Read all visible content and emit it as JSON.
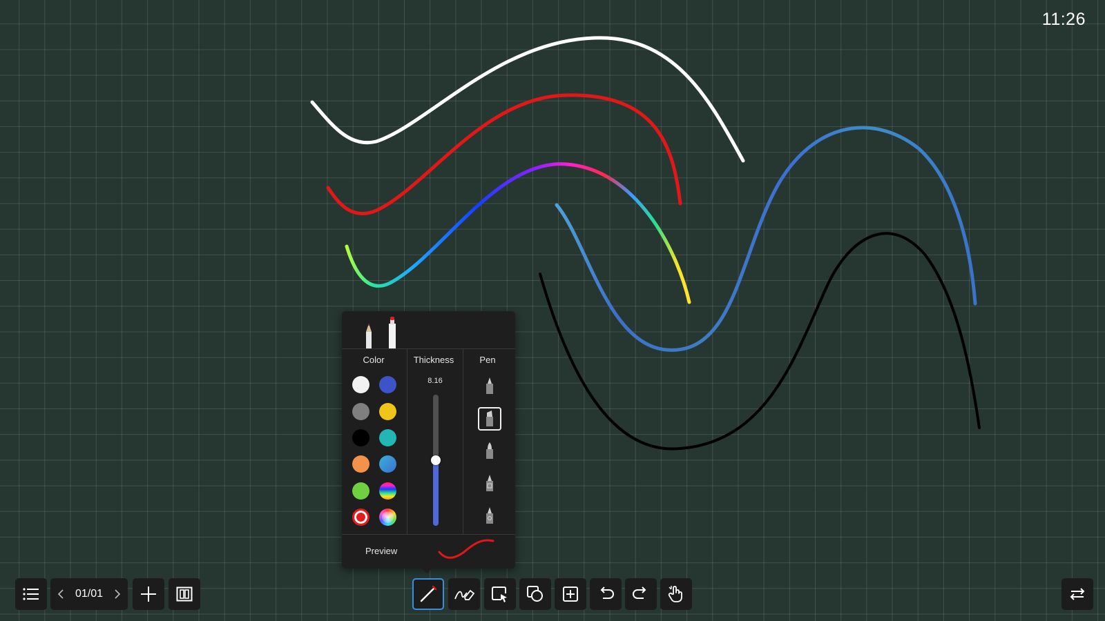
{
  "status_bar": {
    "time": "11:26"
  },
  "canvas": {
    "background": "#263631",
    "grid_color": "#3f4f4a",
    "strokes": [
      {
        "color": "#ffffff",
        "style": "solid"
      },
      {
        "color": "#e01818",
        "style": "solid"
      },
      {
        "color": "rainbow",
        "style": "gradient"
      },
      {
        "color": "blue-teal",
        "style": "gradient"
      },
      {
        "color": "#000000",
        "style": "solid"
      }
    ]
  },
  "pen_panel": {
    "pen_tabs": [
      {
        "icon": "pencil-tip-icon",
        "selected": false
      },
      {
        "icon": "marker-red-icon",
        "selected": true
      }
    ],
    "color_header": "Color",
    "thickness_header": "Thickness",
    "pen_header": "Pen",
    "colors": [
      {
        "name": "white",
        "value": "#f2f2f2",
        "selected": false
      },
      {
        "name": "blue",
        "value": "#3d54c9",
        "selected": false
      },
      {
        "name": "gray",
        "value": "#7f7f7f",
        "selected": false
      },
      {
        "name": "yellow",
        "value": "#f0c419",
        "selected": false
      },
      {
        "name": "black",
        "value": "#000000",
        "selected": false
      },
      {
        "name": "teal",
        "value": "#22b7b5",
        "selected": false
      },
      {
        "name": "orange",
        "value": "#f5924a",
        "selected": false
      },
      {
        "name": "blue-teal-gradient",
        "value": "gradient",
        "selected": false
      },
      {
        "name": "green",
        "value": "#6fd042",
        "selected": false
      },
      {
        "name": "rainbow-gradient",
        "value": "gradient",
        "selected": false
      },
      {
        "name": "red",
        "value": "#e31c1c",
        "selected": true
      },
      {
        "name": "color-wheel",
        "value": "picker",
        "selected": false
      }
    ],
    "thickness_value": "8.16",
    "thickness_level": 0.5,
    "pen_types": [
      {
        "icon": "fine-pen-icon",
        "selected": false
      },
      {
        "icon": "chisel-marker-icon",
        "selected": true
      },
      {
        "icon": "brush-pen-icon",
        "selected": false
      },
      {
        "icon": "pattern-pen-icon",
        "selected": false
      },
      {
        "icon": "texture-pen-icon",
        "selected": false
      }
    ],
    "preview_label": "Preview",
    "preview_color": "#e01818"
  },
  "toolbar": {
    "menu_icon": "menu-list-icon",
    "page_indicator": "01/01",
    "add_page_icon": "plus-icon",
    "page_overview_icon": "page-overview-icon",
    "tools": [
      {
        "icon": "pen-icon",
        "active": true
      },
      {
        "icon": "eraser-icon",
        "active": false
      },
      {
        "icon": "lasso-select-icon",
        "active": false
      },
      {
        "icon": "shapes-icon",
        "active": false
      },
      {
        "icon": "insert-icon",
        "active": false
      },
      {
        "icon": "undo-icon",
        "active": false
      },
      {
        "icon": "redo-icon",
        "active": false
      },
      {
        "icon": "hand-roam-icon",
        "active": false
      }
    ],
    "switch_icon": "switch-arrows-icon"
  }
}
